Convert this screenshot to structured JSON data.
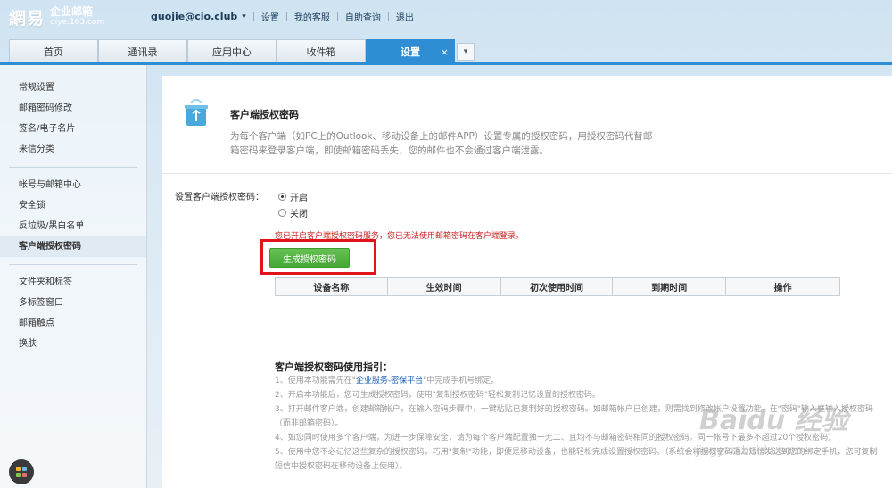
{
  "logo": {
    "brand": "網易",
    "name": "企业邮箱",
    "domain": "qiye.163.com"
  },
  "topnav": {
    "user": "guojie@cio.club",
    "links": [
      "设置",
      "我的客服",
      "自助查询",
      "退出"
    ]
  },
  "tabs": [
    "首页",
    "通讯录",
    "应用中心",
    "收件箱",
    "设置"
  ],
  "tab_close": "×",
  "tab_more": "▾",
  "sidebar": {
    "group1": [
      "常规设置",
      "邮箱密码修改",
      "签名/电子名片",
      "来信分类"
    ],
    "group2": [
      "帐号与邮箱中心",
      "安全锁",
      "反垃圾/黑白名单",
      "客户端授权密码"
    ],
    "group3": [
      "文件夹和标签",
      "多标签窗口",
      "邮箱触点",
      "换肤"
    ]
  },
  "main": {
    "title": "客户端授权密码",
    "desc": "为每个客户端（如PC上的Outlook、移动设备上的邮件APP）设置专属的授权密码，用授权密码代替邮箱密码来登录客户端，即使邮箱密码丢失，您的邮件也不会通过客户端泄露。",
    "setting_label": "设置客户端授权密码：",
    "radio_on": "开启",
    "radio_off": "关闭",
    "warning": "您已开启客户端授权密码服务，您已无法使用邮箱密码在客户端登录。",
    "gen_button": "生成授权密码",
    "table_headers": [
      "设备名称",
      "生效时间",
      "初次使用时间",
      "到期时间",
      "操作"
    ],
    "guide_title": "客户端授权密码使用指引：",
    "guide": {
      "l1a": "1、使用本功能需先在\"",
      "l1_link": "企业服务-密保平台",
      "l1b": "\"中完成手机号绑定。",
      "l2": "2、开启本功能后，您可生成授权密码，使用\"复制授权密码\"轻松复制记忆设置的授权密码。",
      "l3": "3、打开邮件客户端，创建邮箱帐户，在输入密码步骤中，一键粘贴已复制好的授权密码。如邮箱帐户已创建，则需找到修改帐户设置功能，在\"密码\"输入框输入授权密码（而非邮箱密码）。",
      "l4": "4、如您同时使用多个客户端，为进一步保障安全，请为每个客户端配置独一无二、且均不与邮箱密码相同的授权密码。同一帐号下最多不超过20个授权密码）",
      "l5": "5、使用中您不必记忆这些复杂的授权密码，巧用\"复制\"功能，即便是移动设备，也能轻松完成设置授权密码。（系统会将授权密码通过短信发送到您的绑定手机，您可复制短信中授权密码在移动设备上使用）。"
    }
  },
  "watermark": {
    "text": "Baidu 经验",
    "url": "jingyan.baidu.com"
  },
  "colors": {
    "accent": "#2f8dd4",
    "highlight_box": "#e0141a",
    "button": "#52b041",
    "warning": "#c82020"
  }
}
